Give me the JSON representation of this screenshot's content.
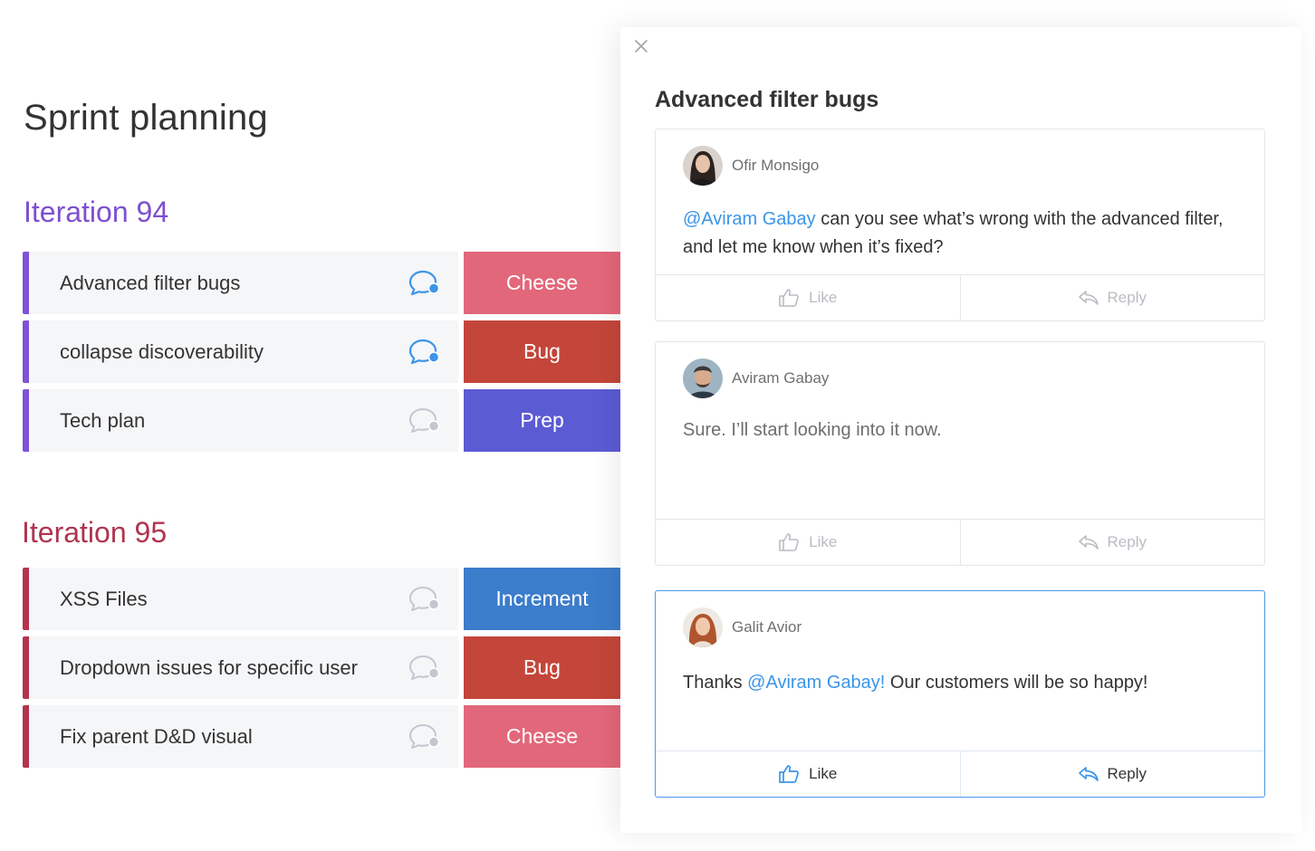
{
  "board": {
    "title": "Sprint planning",
    "groups": [
      {
        "title": "Iteration 94",
        "color": "#7e52d6",
        "items": [
          {
            "name": "Advanced filter bugs",
            "has_updates": true,
            "status": "Cheese",
            "status_color": "#e2677a"
          },
          {
            "name": "collapse discoverability",
            "has_updates": true,
            "status": "Bug",
            "status_color": "#c4463a"
          },
          {
            "name": "Tech plan",
            "has_updates": false,
            "status": "Prep",
            "status_color": "#5b5bd4"
          }
        ]
      },
      {
        "title": "Iteration 95",
        "color": "#b4334d",
        "items": [
          {
            "name": "XSS Files",
            "has_updates": false,
            "status": "Increment",
            "status_color": "#3b7ccb"
          },
          {
            "name": "Dropdown issues for specific user",
            "has_updates": false,
            "status": "Bug",
            "status_color": "#c4463a"
          },
          {
            "name": "Fix parent D&D visual",
            "has_updates": false,
            "status": "Cheese",
            "status_color": "#e2677a"
          }
        ]
      }
    ]
  },
  "panel": {
    "close_icon": "close-icon",
    "title": "Advanced filter bugs",
    "like_label": "Like",
    "reply_label": "Reply",
    "updates": [
      {
        "author": "Ofir Monsigo",
        "mention": "@Aviram Gabay",
        "text": " can you see what’s wrong with the advanced filter, and let me know when it’s fixed?"
      },
      {
        "author": "Aviram Gabay",
        "mention": "",
        "text": "Sure. I’ll start looking into it now."
      },
      {
        "author": "Galit Avior",
        "prefix": "Thanks ",
        "mention": "@Aviram Gabay!",
        "text": " Our customers will be so happy!"
      }
    ]
  },
  "colors": {
    "mention": "#3c95e8",
    "active_border": "#4a9be8",
    "updates_dot": "#3c95e8",
    "no_updates_dot": "#c5c7d0"
  }
}
